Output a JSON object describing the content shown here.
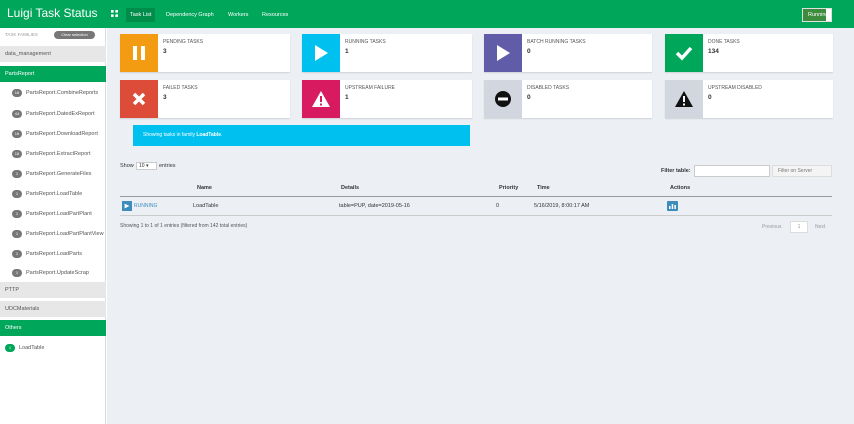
{
  "app_title": "Luigi Task Status",
  "nav": {
    "tabs": [
      "Task List",
      "Dependency Graph",
      "Workers",
      "Resources"
    ],
    "running_label": "Running"
  },
  "sidebar": {
    "header_label": "TASK FAMILIES",
    "clear_label": "Clear selection",
    "groups": [
      {
        "label": "data_management"
      },
      {
        "label": "PartsReport"
      },
      {
        "label": "PTTP"
      },
      {
        "label": "UDCMaterials"
      },
      {
        "label": "Others"
      }
    ],
    "parts_tasks": [
      {
        "count": "16",
        "name": "PartsReport.CombineReports"
      },
      {
        "count": "44",
        "name": "PartsReport.DatedExReport"
      },
      {
        "count": "16",
        "name": "PartsReport.DownloadReport"
      },
      {
        "count": "16",
        "name": "PartsReport.ExtractReport"
      },
      {
        "count": "1",
        "name": "PartsReport.GenerateFiles"
      },
      {
        "count": "1",
        "name": "PartsReport.LoadTable"
      },
      {
        "count": "1",
        "name": "PartsReport.LoadPartPlant"
      },
      {
        "count": "1",
        "name": "PartsReport.LoadPartPlantView"
      },
      {
        "count": "1",
        "name": "PartsReport.LoadParts"
      },
      {
        "count": "1",
        "name": "PartsReport.UpdateScrap"
      }
    ],
    "others_tasks": [
      {
        "count": "1",
        "name": "LoadTable"
      }
    ]
  },
  "boxes": [
    {
      "title": "PENDING TASKS",
      "count": "3",
      "color": "#f39c12",
      "icon": "pause-icon"
    },
    {
      "title": "RUNNING TASKS",
      "count": "1",
      "color": "#00c0ef",
      "icon": "play-icon"
    },
    {
      "title": "BATCH RUNNING TASKS",
      "count": "0",
      "color": "#605ca8",
      "icon": "play-icon"
    },
    {
      "title": "DONE TASKS",
      "count": "134",
      "color": "#00a65a",
      "icon": "check-icon"
    },
    {
      "title": "FAILED TASKS",
      "count": "3",
      "color": "#dd4b39",
      "icon": "x-icon"
    },
    {
      "title": "UPSTREAM FAILURE",
      "count": "1",
      "color": "#d81b60",
      "icon": "warning-icon"
    },
    {
      "title": "DISABLED TASKS",
      "count": "0",
      "color": "#d2d6de",
      "icon": "minus-circle-icon"
    },
    {
      "title": "UPSTREAM DISABLED",
      "count": "0",
      "color": "#d2d6de",
      "icon": "warning-icon"
    }
  ],
  "callout": {
    "prefix": "Showing tasks in family ",
    "family": "LoadTable",
    "suffix": "."
  },
  "table": {
    "show_label": "Show",
    "entries_value": "10",
    "entries_label": "entries",
    "filter_label": "Filter table:",
    "filter_btn": "Filter on Server",
    "headers": [
      "Name",
      "Details",
      "Priority",
      "Time",
      "Actions"
    ],
    "row": {
      "status": "RUNNING",
      "name": "LoadTable",
      "details": "table=PUP, date=2019-05-16",
      "priority": "0",
      "time": "5/16/2019, 8:00:17 AM"
    },
    "info": "Showing 1 to 1 of 1 entries (filtered from 142 total entries)",
    "prev": "Previous",
    "page": "1",
    "next": "Next"
  }
}
